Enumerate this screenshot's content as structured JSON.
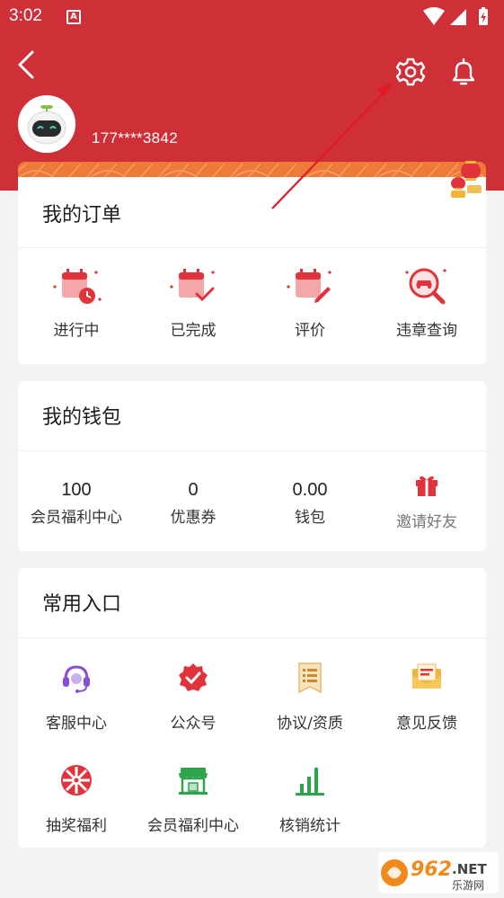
{
  "status_bar": {
    "time": "3:02",
    "app_icon_letter": "A"
  },
  "header": {
    "back_icon": "chevron-left-icon",
    "settings_icon": "gear-icon",
    "bell_icon": "bell-icon",
    "phone": "177****3842"
  },
  "orders": {
    "title": "我的订单",
    "items": [
      {
        "label": "进行中",
        "icon": "calendar-clock-icon"
      },
      {
        "label": "已完成",
        "icon": "calendar-check-icon"
      },
      {
        "label": "评价",
        "icon": "calendar-edit-icon"
      },
      {
        "label": "违章查询",
        "icon": "car-search-icon"
      }
    ]
  },
  "wallet": {
    "title": "我的钱包",
    "items": [
      {
        "value": "100",
        "label": "会员福利中心"
      },
      {
        "value": "0",
        "label": "优惠券"
      },
      {
        "value": "0.00",
        "label": "钱包"
      },
      {
        "label": "邀请好友",
        "icon": "gift-icon"
      }
    ]
  },
  "entries": {
    "title": "常用入口",
    "items": [
      {
        "label": "客服中心",
        "icon": "headset-icon"
      },
      {
        "label": "公众号",
        "icon": "verified-badge-icon"
      },
      {
        "label": "协议/资质",
        "icon": "document-icon"
      },
      {
        "label": "意见反馈",
        "icon": "envelope-icon"
      },
      {
        "label": "抽奖福利",
        "icon": "prize-wheel-icon"
      },
      {
        "label": "会员福利中心",
        "icon": "store-icon"
      },
      {
        "label": "核销统计",
        "icon": "bar-chart-icon"
      }
    ]
  },
  "watermark": {
    "text": "962",
    "suffix": ".NET",
    "subtext": "乐游网"
  },
  "colors": {
    "brand_red": "#cf3038",
    "accent_orange": "#ee7a3a",
    "icon_red": "#e0333b",
    "icon_purple": "#8a4fd6",
    "icon_green": "#2ea44f",
    "icon_yellow": "#f2b53a"
  }
}
